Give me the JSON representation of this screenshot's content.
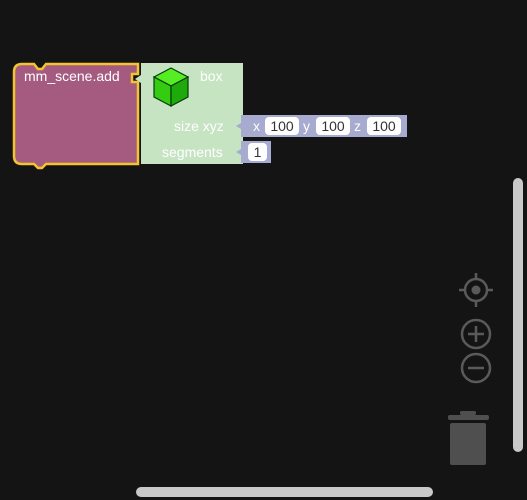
{
  "blocks": {
    "scene_add": {
      "label": "mm_scene.add",
      "color": "#a55b80",
      "highlight": "#f4c430"
    },
    "box": {
      "label": "box",
      "color": "#c6e3c2",
      "icon": "green-cube-icon",
      "size_label": "size xyz",
      "segments_label": "segments"
    },
    "xyz": {
      "color": "#a6abcf",
      "x_label": "x",
      "x_value": "100",
      "y_label": "y",
      "y_value": "100",
      "z_label": "z",
      "z_value": "100"
    },
    "segments_value": "1"
  },
  "controls": {
    "recenter_icon": "target-icon",
    "zoom_in_icon": "plus-circle-icon",
    "zoom_out_icon": "minus-circle-icon",
    "trash_icon": "trash-can-icon"
  }
}
